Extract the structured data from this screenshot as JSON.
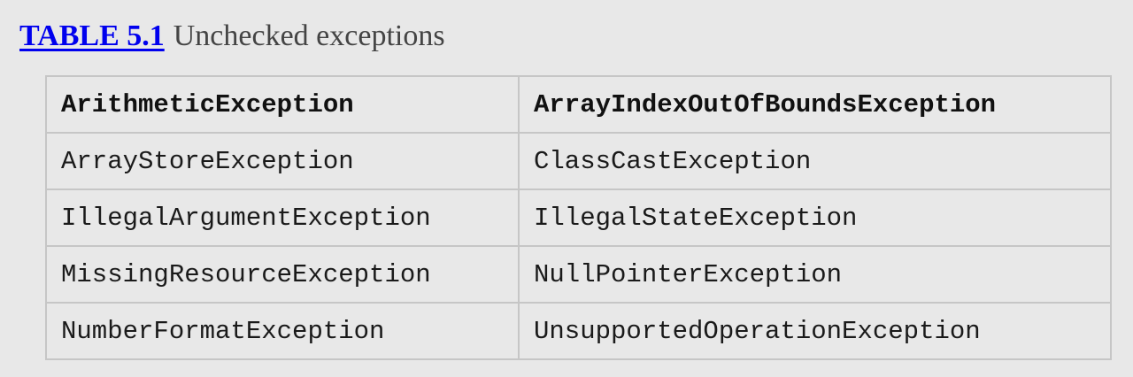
{
  "caption": {
    "link_text": "TABLE 5.1",
    "title": "Unchecked exceptions"
  },
  "table": {
    "rows": [
      [
        "ArithmeticException",
        "ArrayIndexOutOfBoundsException"
      ],
      [
        "ArrayStoreException",
        "ClassCastException"
      ],
      [
        "IllegalArgumentException",
        "IllegalStateException"
      ],
      [
        "MissingResourceException",
        "NullPointerException"
      ],
      [
        "NumberFormatException",
        "UnsupportedOperationException"
      ]
    ]
  },
  "colors": {
    "background": "#e8e8e8",
    "link": "#0000ee",
    "caption_text": "#444444",
    "border": "#c6c6c6"
  }
}
